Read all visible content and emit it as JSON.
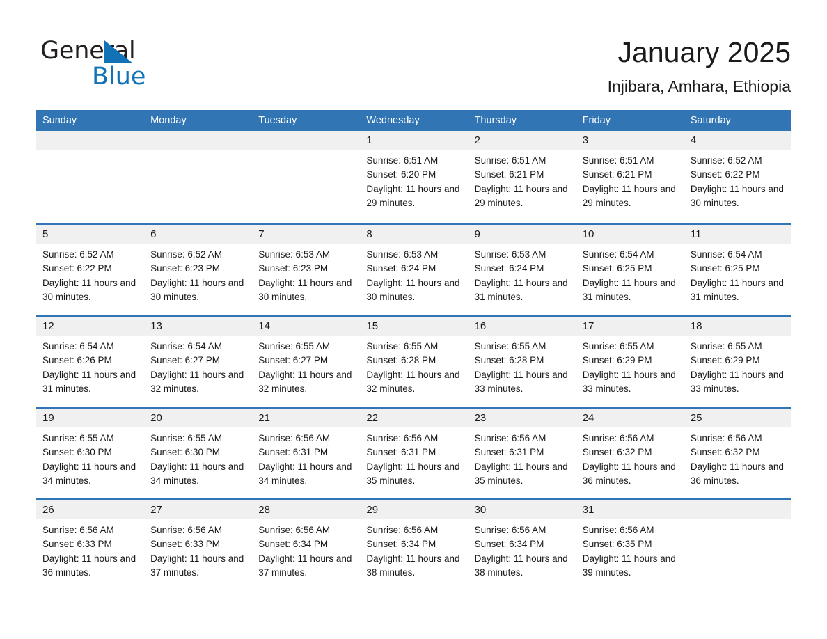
{
  "brand": {
    "name_part1": "General",
    "name_part2": "Blue",
    "triangle_color": "#1272b6",
    "text_color": "#231f20"
  },
  "header": {
    "title": "January 2025",
    "subtitle": "Injibara, Amhara, Ethiopia"
  },
  "colors": {
    "header_blue": "#3175b4",
    "date_band_gray": "#f0f0f0",
    "text": "#1a1a1a",
    "white": "#ffffff"
  },
  "weekdays": [
    "Sunday",
    "Monday",
    "Tuesday",
    "Wednesday",
    "Thursday",
    "Friday",
    "Saturday"
  ],
  "weeks": [
    [
      {
        "date": "",
        "sunrise": "",
        "sunset": "",
        "daylight": ""
      },
      {
        "date": "",
        "sunrise": "",
        "sunset": "",
        "daylight": ""
      },
      {
        "date": "",
        "sunrise": "",
        "sunset": "",
        "daylight": ""
      },
      {
        "date": "1",
        "sunrise": "Sunrise: 6:51 AM",
        "sunset": "Sunset: 6:20 PM",
        "daylight": "Daylight: 11 hours and 29 minutes."
      },
      {
        "date": "2",
        "sunrise": "Sunrise: 6:51 AM",
        "sunset": "Sunset: 6:21 PM",
        "daylight": "Daylight: 11 hours and 29 minutes."
      },
      {
        "date": "3",
        "sunrise": "Sunrise: 6:51 AM",
        "sunset": "Sunset: 6:21 PM",
        "daylight": "Daylight: 11 hours and 29 minutes."
      },
      {
        "date": "4",
        "sunrise": "Sunrise: 6:52 AM",
        "sunset": "Sunset: 6:22 PM",
        "daylight": "Daylight: 11 hours and 30 minutes."
      }
    ],
    [
      {
        "date": "5",
        "sunrise": "Sunrise: 6:52 AM",
        "sunset": "Sunset: 6:22 PM",
        "daylight": "Daylight: 11 hours and 30 minutes."
      },
      {
        "date": "6",
        "sunrise": "Sunrise: 6:52 AM",
        "sunset": "Sunset: 6:23 PM",
        "daylight": "Daylight: 11 hours and 30 minutes."
      },
      {
        "date": "7",
        "sunrise": "Sunrise: 6:53 AM",
        "sunset": "Sunset: 6:23 PM",
        "daylight": "Daylight: 11 hours and 30 minutes."
      },
      {
        "date": "8",
        "sunrise": "Sunrise: 6:53 AM",
        "sunset": "Sunset: 6:24 PM",
        "daylight": "Daylight: 11 hours and 30 minutes."
      },
      {
        "date": "9",
        "sunrise": "Sunrise: 6:53 AM",
        "sunset": "Sunset: 6:24 PM",
        "daylight": "Daylight: 11 hours and 31 minutes."
      },
      {
        "date": "10",
        "sunrise": "Sunrise: 6:54 AM",
        "sunset": "Sunset: 6:25 PM",
        "daylight": "Daylight: 11 hours and 31 minutes."
      },
      {
        "date": "11",
        "sunrise": "Sunrise: 6:54 AM",
        "sunset": "Sunset: 6:25 PM",
        "daylight": "Daylight: 11 hours and 31 minutes."
      }
    ],
    [
      {
        "date": "12",
        "sunrise": "Sunrise: 6:54 AM",
        "sunset": "Sunset: 6:26 PM",
        "daylight": "Daylight: 11 hours and 31 minutes."
      },
      {
        "date": "13",
        "sunrise": "Sunrise: 6:54 AM",
        "sunset": "Sunset: 6:27 PM",
        "daylight": "Daylight: 11 hours and 32 minutes."
      },
      {
        "date": "14",
        "sunrise": "Sunrise: 6:55 AM",
        "sunset": "Sunset: 6:27 PM",
        "daylight": "Daylight: 11 hours and 32 minutes."
      },
      {
        "date": "15",
        "sunrise": "Sunrise: 6:55 AM",
        "sunset": "Sunset: 6:28 PM",
        "daylight": "Daylight: 11 hours and 32 minutes."
      },
      {
        "date": "16",
        "sunrise": "Sunrise: 6:55 AM",
        "sunset": "Sunset: 6:28 PM",
        "daylight": "Daylight: 11 hours and 33 minutes."
      },
      {
        "date": "17",
        "sunrise": "Sunrise: 6:55 AM",
        "sunset": "Sunset: 6:29 PM",
        "daylight": "Daylight: 11 hours and 33 minutes."
      },
      {
        "date": "18",
        "sunrise": "Sunrise: 6:55 AM",
        "sunset": "Sunset: 6:29 PM",
        "daylight": "Daylight: 11 hours and 33 minutes."
      }
    ],
    [
      {
        "date": "19",
        "sunrise": "Sunrise: 6:55 AM",
        "sunset": "Sunset: 6:30 PM",
        "daylight": "Daylight: 11 hours and 34 minutes."
      },
      {
        "date": "20",
        "sunrise": "Sunrise: 6:55 AM",
        "sunset": "Sunset: 6:30 PM",
        "daylight": "Daylight: 11 hours and 34 minutes."
      },
      {
        "date": "21",
        "sunrise": "Sunrise: 6:56 AM",
        "sunset": "Sunset: 6:31 PM",
        "daylight": "Daylight: 11 hours and 34 minutes."
      },
      {
        "date": "22",
        "sunrise": "Sunrise: 6:56 AM",
        "sunset": "Sunset: 6:31 PM",
        "daylight": "Daylight: 11 hours and 35 minutes."
      },
      {
        "date": "23",
        "sunrise": "Sunrise: 6:56 AM",
        "sunset": "Sunset: 6:31 PM",
        "daylight": "Daylight: 11 hours and 35 minutes."
      },
      {
        "date": "24",
        "sunrise": "Sunrise: 6:56 AM",
        "sunset": "Sunset: 6:32 PM",
        "daylight": "Daylight: 11 hours and 36 minutes."
      },
      {
        "date": "25",
        "sunrise": "Sunrise: 6:56 AM",
        "sunset": "Sunset: 6:32 PM",
        "daylight": "Daylight: 11 hours and 36 minutes."
      }
    ],
    [
      {
        "date": "26",
        "sunrise": "Sunrise: 6:56 AM",
        "sunset": "Sunset: 6:33 PM",
        "daylight": "Daylight: 11 hours and 36 minutes."
      },
      {
        "date": "27",
        "sunrise": "Sunrise: 6:56 AM",
        "sunset": "Sunset: 6:33 PM",
        "daylight": "Daylight: 11 hours and 37 minutes."
      },
      {
        "date": "28",
        "sunrise": "Sunrise: 6:56 AM",
        "sunset": "Sunset: 6:34 PM",
        "daylight": "Daylight: 11 hours and 37 minutes."
      },
      {
        "date": "29",
        "sunrise": "Sunrise: 6:56 AM",
        "sunset": "Sunset: 6:34 PM",
        "daylight": "Daylight: 11 hours and 38 minutes."
      },
      {
        "date": "30",
        "sunrise": "Sunrise: 6:56 AM",
        "sunset": "Sunset: 6:34 PM",
        "daylight": "Daylight: 11 hours and 38 minutes."
      },
      {
        "date": "31",
        "sunrise": "Sunrise: 6:56 AM",
        "sunset": "Sunset: 6:35 PM",
        "daylight": "Daylight: 11 hours and 39 minutes."
      },
      {
        "date": "",
        "sunrise": "",
        "sunset": "",
        "daylight": ""
      }
    ]
  ]
}
